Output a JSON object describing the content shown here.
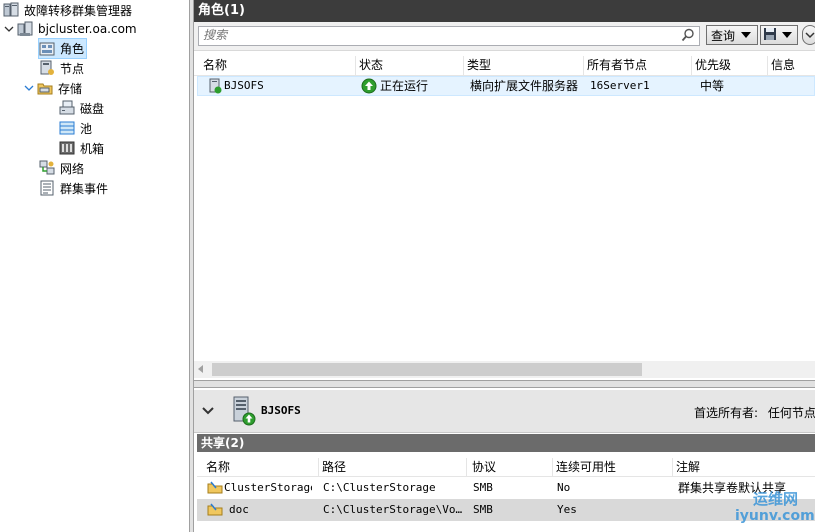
{
  "tree": {
    "root": "故障转移群集管理器",
    "cluster": "bjcluster.oa.com",
    "items": [
      {
        "label": "角色",
        "icon": "roles-icon"
      },
      {
        "label": "节点",
        "icon": "nodes-icon"
      },
      {
        "label": "存储",
        "icon": "storage-icon"
      },
      {
        "label": "磁盘",
        "icon": "disk-icon"
      },
      {
        "label": "池",
        "icon": "pool-icon"
      },
      {
        "label": "机箱",
        "icon": "enclosure-icon"
      },
      {
        "label": "网络",
        "icon": "network-icon"
      },
      {
        "label": "群集事件",
        "icon": "cluster-events-icon"
      }
    ]
  },
  "roles": {
    "title": "角色(1)",
    "search_placeholder": "搜索",
    "query_label": "查询",
    "columns": [
      "名称",
      "状态",
      "类型",
      "所有者节点",
      "优先级",
      "信息"
    ],
    "rows": [
      {
        "name": "BJSOFS",
        "status": "正在运行",
        "type": "横向扩展文件服务器",
        "owner": "16Server1",
        "priority": "中等",
        "info": ""
      }
    ]
  },
  "details": {
    "name": "BJSOFS",
    "owner_label": "首选所有者:",
    "owner_value": "任何节点",
    "shares_title": "共享(2)",
    "columns": [
      "名称",
      "路径",
      "协议",
      "连续可用性",
      "注解"
    ],
    "rows": [
      {
        "name": "ClusterStorage$",
        "path": "C:\\ClusterStorage",
        "protocol": "SMB",
        "ca": "No",
        "remark": "群集共享卷默认共享"
      },
      {
        "name": "doc",
        "path": "C:\\ClusterStorage\\Vo…",
        "protocol": "SMB",
        "ca": "Yes",
        "remark": ""
      }
    ]
  },
  "watermark": {
    "line1": "运维网",
    "line2": "iyunv.com"
  },
  "colors": {
    "title_bar": "#3c3c3c",
    "selection": "#cce8ff",
    "running_green": "#2e9e2e"
  }
}
